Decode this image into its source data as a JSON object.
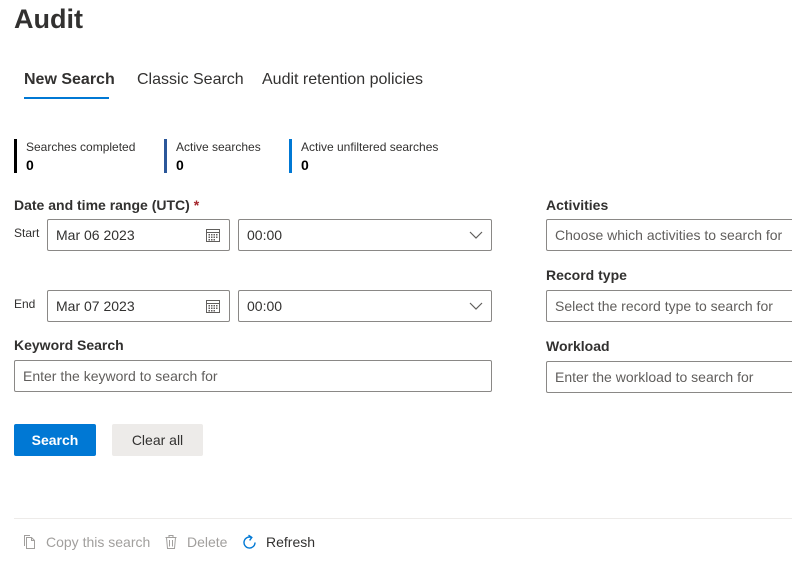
{
  "page": {
    "title": "Audit"
  },
  "tabs": [
    {
      "label": "New Search",
      "active": true
    },
    {
      "label": "Classic Search",
      "active": false
    },
    {
      "label": "Audit retention policies",
      "active": false
    }
  ],
  "stats": [
    {
      "label": "Searches completed",
      "value": "0",
      "color": "#000000"
    },
    {
      "label": "Active searches",
      "value": "0",
      "color": "#2b579a"
    },
    {
      "label": "Active unfiltered searches",
      "value": "0",
      "color": "#0078d4"
    }
  ],
  "date_range": {
    "label": "Date and time range (UTC)",
    "required_mark": "*",
    "start": {
      "label": "Start",
      "date": "Mar 06 2023",
      "time": "00:00"
    },
    "end": {
      "label": "End",
      "date": "Mar 07 2023",
      "time": "00:00"
    }
  },
  "keyword": {
    "label": "Keyword Search",
    "placeholder": "Enter the keyword to search for"
  },
  "activities": {
    "label": "Activities",
    "placeholder": "Choose which activities to search for"
  },
  "record_type": {
    "label": "Record type",
    "placeholder": "Select the record type to search for"
  },
  "workload": {
    "label": "Workload",
    "placeholder": "Enter the workload to search for"
  },
  "buttons": {
    "search": "Search",
    "clear": "Clear all"
  },
  "commands": {
    "copy": "Copy this search",
    "delete": "Delete",
    "refresh": "Refresh"
  },
  "colors": {
    "accent": "#0078d4",
    "required": "#a4262c"
  }
}
